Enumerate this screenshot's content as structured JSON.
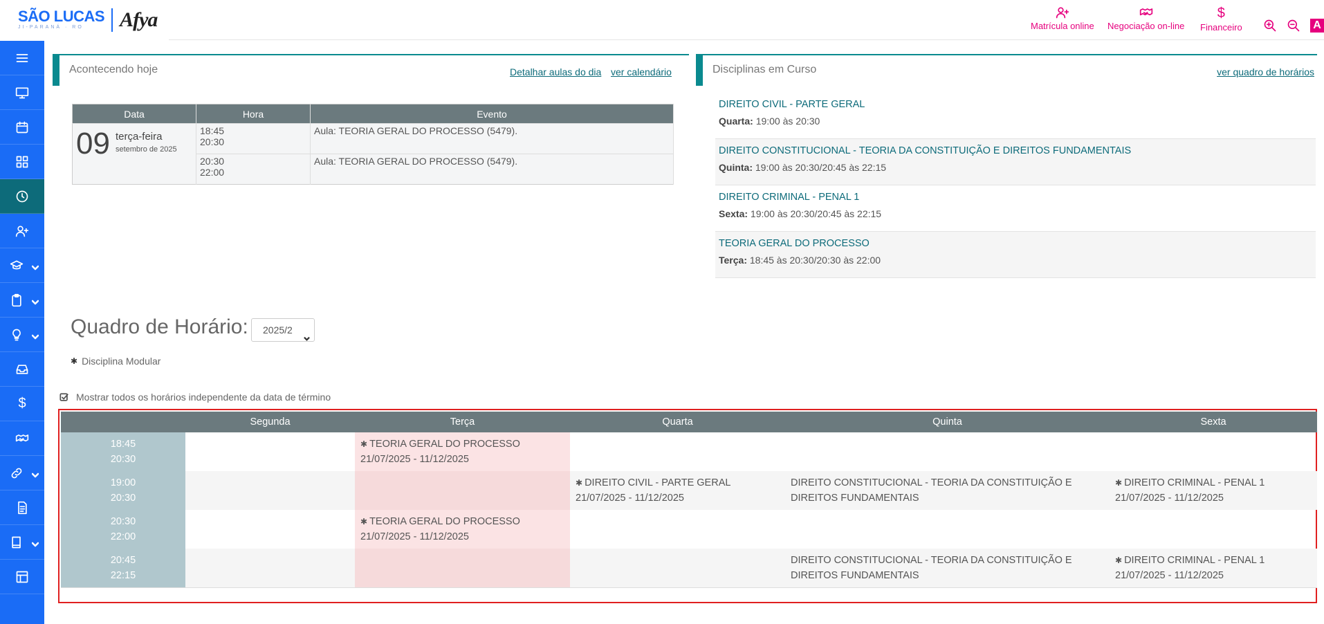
{
  "header": {
    "logo_name": "SÃO LUCAS",
    "logo_sub": "JI-PARANÁ · RO",
    "logo_brand": "Afya",
    "nav": [
      {
        "label": "Matrícula online",
        "icon": "user-plus-icon"
      },
      {
        "label": "Negociação on-line",
        "icon": "handshake-icon"
      },
      {
        "label": "Financeiro",
        "icon": "dollar-icon"
      }
    ],
    "contrast_label": "A"
  },
  "sidebar": {
    "items": [
      {
        "icon": "menu-icon"
      },
      {
        "icon": "monitor-icon"
      },
      {
        "icon": "calendar-icon"
      },
      {
        "icon": "grid-icon"
      },
      {
        "icon": "clock-icon",
        "active": true
      },
      {
        "icon": "user-plus-icon"
      },
      {
        "icon": "graduation-cap-icon",
        "chevron": true
      },
      {
        "icon": "clipboard-icon",
        "chevron": true
      },
      {
        "icon": "lightbulb-icon",
        "chevron": true
      },
      {
        "icon": "inbox-icon"
      },
      {
        "icon": "dollar-icon"
      },
      {
        "icon": "handshake-icon"
      },
      {
        "icon": "link-icon",
        "chevron": true
      },
      {
        "icon": "document-icon"
      },
      {
        "icon": "book-icon",
        "chevron": true
      },
      {
        "icon": "layout-icon"
      }
    ]
  },
  "today": {
    "title": "Acontecendo hoje",
    "link_detail": "Detalhar aulas do dia",
    "link_calendar": "ver calendário",
    "columns": [
      "Data",
      "Hora",
      "Evento"
    ],
    "day": "09",
    "weekday": "terça-feira",
    "month": "setembro de 2025",
    "rows": [
      {
        "start": "18:45",
        "end": "20:30",
        "event": "Aula: TEORIA GERAL DO PROCESSO (5479)."
      },
      {
        "start": "20:30",
        "end": "22:00",
        "event": "Aula: TEORIA GERAL DO PROCESSO (5479)."
      }
    ]
  },
  "courses": {
    "title": "Disciplinas em Curso",
    "link": "ver quadro de horários",
    "items": [
      {
        "name": "DIREITO CIVIL - PARTE GERAL",
        "day": "Quarta:",
        "time": "19:00 às 20:30"
      },
      {
        "name": "DIREITO CONSTITUCIONAL - TEORIA DA CONSTITUIÇÃO E DIREITOS FUNDAMENTAIS",
        "day": "Quinta:",
        "time": "19:00 às 20:30/20:45 às 22:15"
      },
      {
        "name": "DIREITO CRIMINAL - PENAL 1",
        "day": "Sexta:",
        "time": "19:00 às 20:30/20:45 às 22:15"
      },
      {
        "name": "TEORIA GERAL DO PROCESSO",
        "day": "Terça:",
        "time": "18:45 às 20:30/20:30 às 22:00"
      }
    ]
  },
  "schedule": {
    "title": "Quadro de Horário:",
    "period": "2025/2",
    "legend": "Disciplina Modular",
    "checkbox_label": "Mostrar todos os horários independente da data de término",
    "days": [
      "Segunda",
      "Terça",
      "Quarta",
      "Quinta",
      "Sexta"
    ],
    "rows": [
      {
        "start": "18:45",
        "end": "20:30",
        "cells": [
          null,
          {
            "name": "TEORIA GERAL DO PROCESSO",
            "dates": "21/07/2025 - 11/12/2025",
            "modular": true
          },
          null,
          null,
          null
        ]
      },
      {
        "start": "19:00",
        "end": "20:30",
        "cells": [
          null,
          null,
          {
            "name": "DIREITO CIVIL - PARTE GERAL",
            "dates": "21/07/2025 - 11/12/2025",
            "modular": true
          },
          {
            "name": "DIREITO CONSTITUCIONAL - TEORIA DA CONSTITUIÇÃO E DIREITOS FUNDAMENTAIS",
            "dates": "",
            "modular": false
          },
          {
            "name": "DIREITO CRIMINAL - PENAL 1",
            "dates": "21/07/2025 - 11/12/2025",
            "modular": true
          }
        ]
      },
      {
        "start": "20:30",
        "end": "22:00",
        "cells": [
          null,
          {
            "name": "TEORIA GERAL DO PROCESSO",
            "dates": "21/07/2025 - 11/12/2025",
            "modular": true
          },
          null,
          null,
          null
        ]
      },
      {
        "start": "20:45",
        "end": "22:15",
        "cells": [
          null,
          null,
          null,
          {
            "name": "DIREITO CONSTITUCIONAL - TEORIA DA CONSTITUIÇÃO E DIREITOS FUNDAMENTAIS",
            "dates": "",
            "modular": false
          },
          {
            "name": "DIREITO CRIMINAL - PENAL 1",
            "dates": "21/07/2025 - 11/12/2025",
            "modular": true
          }
        ]
      }
    ]
  },
  "colors": {
    "sidebar": "#1a6cf6",
    "sidebar_active": "#0d6b7a",
    "accent": "#e6007e",
    "teal": "#0a8a8f",
    "table_header": "#6b7a7e",
    "highlight_border": "#e02020"
  }
}
